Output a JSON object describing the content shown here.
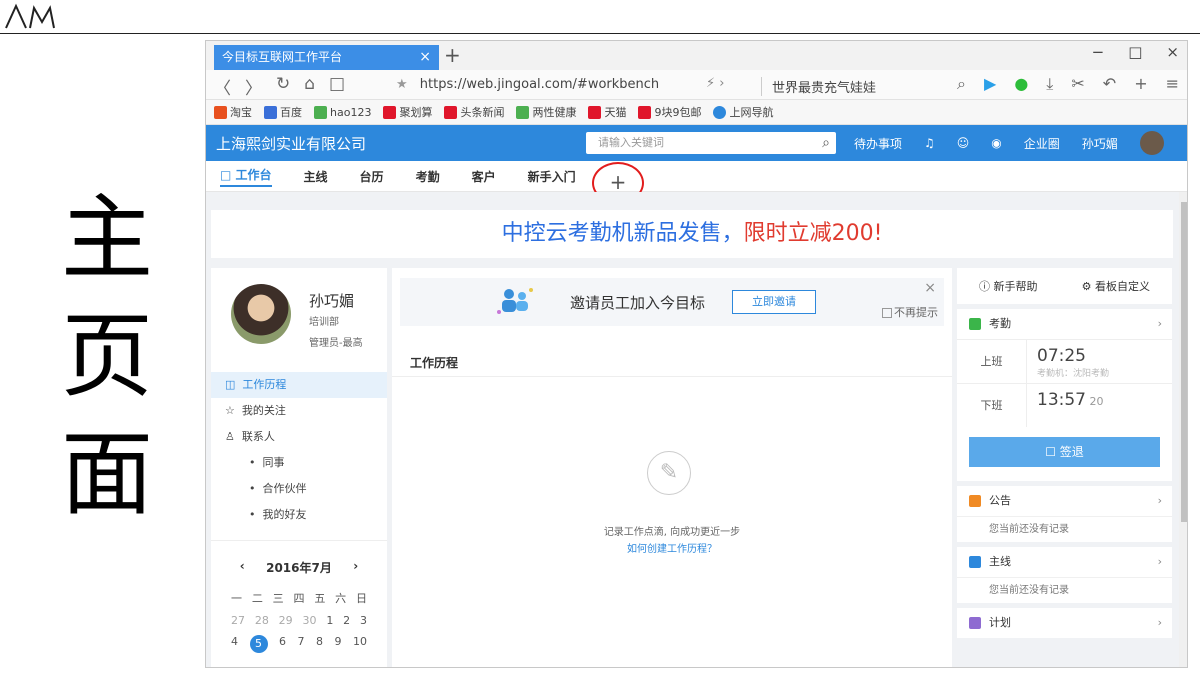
{
  "slide": {
    "title_chars": [
      "主",
      "页",
      "面"
    ]
  },
  "browser": {
    "tab_title": "今目标互联网工作平台",
    "tab_close": "×",
    "new_tab": "+",
    "win_controls": [
      "−",
      "□",
      "×"
    ],
    "url": "https://web.jingoal.com/#workbench",
    "search_hint": "世界最贵充气娃娃",
    "bookmarks": [
      {
        "label": "淘宝",
        "color": "#e8501e"
      },
      {
        "label": "百度",
        "color": "#3a6fd8"
      },
      {
        "label": "hao123",
        "color": "#4caf50"
      },
      {
        "label": "聚划算",
        "color": "#e0162b"
      },
      {
        "label": "头条新闻",
        "color": "#e0162b"
      },
      {
        "label": "两性健康",
        "color": "#4caf50"
      },
      {
        "label": "天猫",
        "color": "#e0162b"
      },
      {
        "label": "9块9包邮",
        "color": "#e0162b"
      },
      {
        "label": "上网导航",
        "color": "#2d88dc"
      }
    ]
  },
  "app": {
    "company": "上海熙剑实业有限公司",
    "search_placeholder": "请输入关键词",
    "header_right": {
      "todo": "待办事项",
      "enterprise": "企业圈",
      "user": "孙巧媚"
    },
    "nav_tabs": [
      "工作台",
      "主线",
      "台历",
      "考勤",
      "客户",
      "新手入门"
    ],
    "nav_plus": "+",
    "banner": {
      "part1": "中控云考勤机新品发售，",
      "part2": "限时立减200!"
    },
    "profile": {
      "name": "孙巧媚",
      "dept": "培训部",
      "role": "管理员-最高"
    },
    "menu": {
      "history": "工作历程",
      "follow": "我的关注",
      "contacts": "联系人",
      "colleagues": "同事",
      "partners": "合作伙伴",
      "friends": "我的好友"
    },
    "calendar": {
      "month": "2016年7月",
      "weekdays": [
        "一",
        "二",
        "三",
        "四",
        "五",
        "六",
        "日"
      ],
      "row1": [
        "27",
        "28",
        "29",
        "30",
        "1",
        "2",
        "3"
      ],
      "row2": [
        "4",
        "5",
        "6",
        "7",
        "8",
        "9",
        "10"
      ],
      "today": "5"
    },
    "invite": {
      "text": "邀请员工加入今目标",
      "button": "立即邀请",
      "dismiss": "不再提示"
    },
    "work": {
      "title": "工作历程",
      "empty_text": "记录工作点滴, 向成功更近一步",
      "empty_link": "如何创建工作历程？"
    },
    "right": {
      "help": "新手帮助",
      "board": "看板自定义",
      "attendance": "考勤",
      "on_label": "上班",
      "on_time": "07:25",
      "on_source": "考勤机：沈阳考勤",
      "off_label": "下班",
      "off_time": "13:57",
      "off_sec": "20",
      "signout": "签退",
      "notice": "公告",
      "notice_empty": "您当前还没有记录",
      "mainline": "主线",
      "mainline_empty": "您当前还没有记录",
      "plan": "计划"
    }
  }
}
